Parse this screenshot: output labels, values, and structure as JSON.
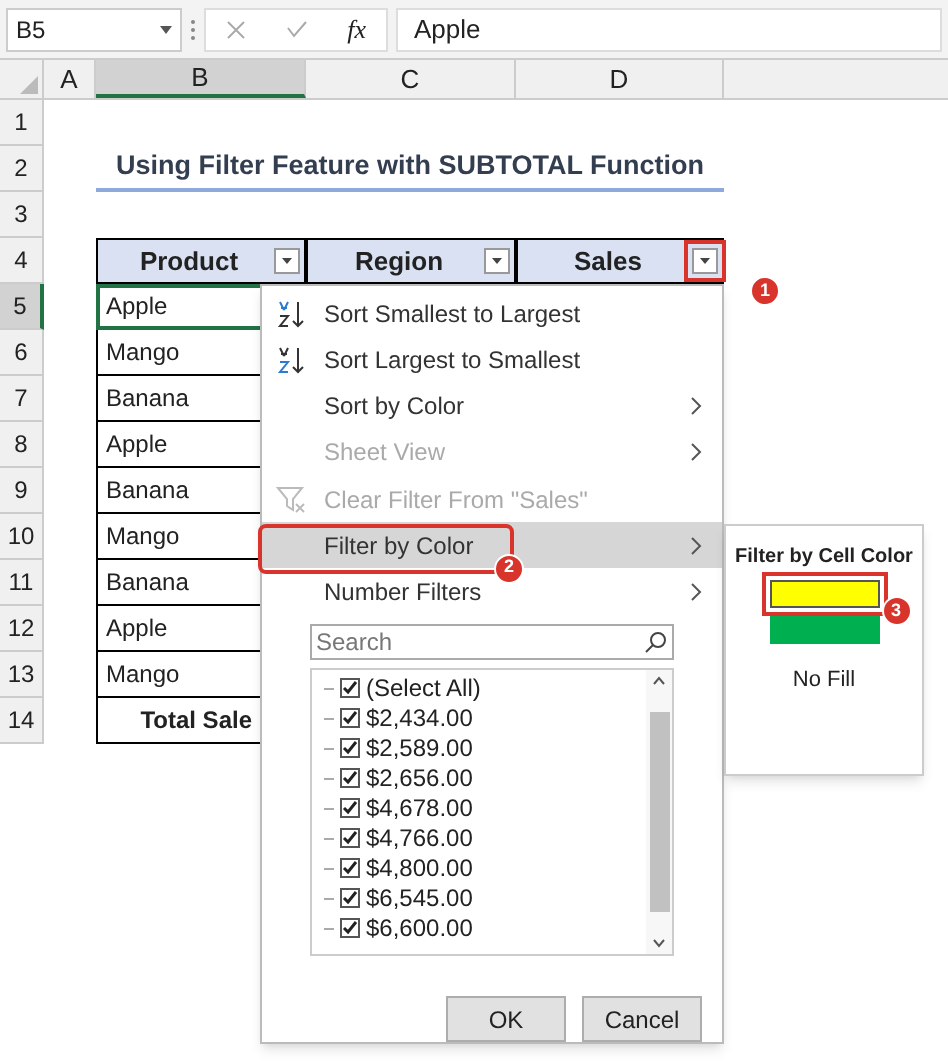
{
  "formula_bar": {
    "name_box": "B5",
    "fx": "fx",
    "value": "Apple"
  },
  "columns": [
    {
      "label": "A",
      "selected": false
    },
    {
      "label": "B",
      "selected": true
    },
    {
      "label": "C",
      "selected": false
    },
    {
      "label": "D",
      "selected": false
    }
  ],
  "rows": [
    {
      "number": "1",
      "selected": false,
      "kind": "empty"
    },
    {
      "number": "2",
      "selected": false,
      "kind": "title",
      "text": "Using Filter Feature with SUBTOTAL Function"
    },
    {
      "number": "3",
      "selected": false,
      "kind": "empty"
    },
    {
      "number": "4",
      "selected": false,
      "kind": "header",
      "cells": [
        {
          "text": "Product"
        },
        {
          "text": "Region"
        },
        {
          "text": "Sales",
          "callout": "1"
        }
      ]
    },
    {
      "number": "5",
      "selected": true,
      "kind": "data",
      "text": "Apple"
    },
    {
      "number": "6",
      "selected": false,
      "kind": "data",
      "text": "Mango"
    },
    {
      "number": "7",
      "selected": false,
      "kind": "data",
      "text": "Banana"
    },
    {
      "number": "8",
      "selected": false,
      "kind": "data",
      "text": "Apple"
    },
    {
      "number": "9",
      "selected": false,
      "kind": "data",
      "text": "Banana"
    },
    {
      "number": "10",
      "selected": false,
      "kind": "data",
      "text": "Mango"
    },
    {
      "number": "11",
      "selected": false,
      "kind": "data",
      "text": "Banana"
    },
    {
      "number": "12",
      "selected": false,
      "kind": "data",
      "text": "Apple"
    },
    {
      "number": "13",
      "selected": false,
      "kind": "data",
      "text": "Mango"
    },
    {
      "number": "14",
      "selected": false,
      "kind": "total",
      "text": "Total Sale"
    }
  ],
  "menu": {
    "items": [
      {
        "kind": "sort-asc",
        "label": "Sort Smallest to Largest",
        "disabled": false,
        "selected": false
      },
      {
        "kind": "sort-desc",
        "label": "Sort Largest to Smallest",
        "disabled": false,
        "selected": false
      },
      {
        "kind": "submenu",
        "label": "Sort by Color",
        "disabled": false,
        "selected": false
      },
      {
        "kind": "submenu",
        "label": "Sheet View",
        "disabled": true,
        "selected": false
      },
      {
        "kind": "clear",
        "label": "Clear Filter From \"Sales\"",
        "disabled": true,
        "selected": false
      },
      {
        "kind": "submenu",
        "label": "Filter by Color",
        "disabled": false,
        "selected": true,
        "callout": "2"
      },
      {
        "kind": "submenu",
        "label": "Number Filters",
        "disabled": false,
        "selected": false
      }
    ],
    "search": {
      "placeholder": "Search"
    },
    "values": [
      {
        "label": "(Select All)",
        "checked": true
      },
      {
        "label": "$2,434.00",
        "checked": true
      },
      {
        "label": "$2,589.00",
        "checked": true
      },
      {
        "label": "$2,656.00",
        "checked": true
      },
      {
        "label": "$4,678.00",
        "checked": true
      },
      {
        "label": "$4,766.00",
        "checked": true
      },
      {
        "label": "$4,800.00",
        "checked": true
      },
      {
        "label": "$6,545.00",
        "checked": true
      },
      {
        "label": "$6,600.00",
        "checked": true
      }
    ],
    "buttons": [
      "OK",
      "Cancel"
    ]
  },
  "submenu": {
    "title": "Filter by Cell Color",
    "swatches": [
      {
        "color": "#ffff00",
        "selected": true,
        "callout": "3"
      },
      {
        "color": "#00b050",
        "selected": false
      }
    ],
    "no_fill": "No Fill"
  }
}
